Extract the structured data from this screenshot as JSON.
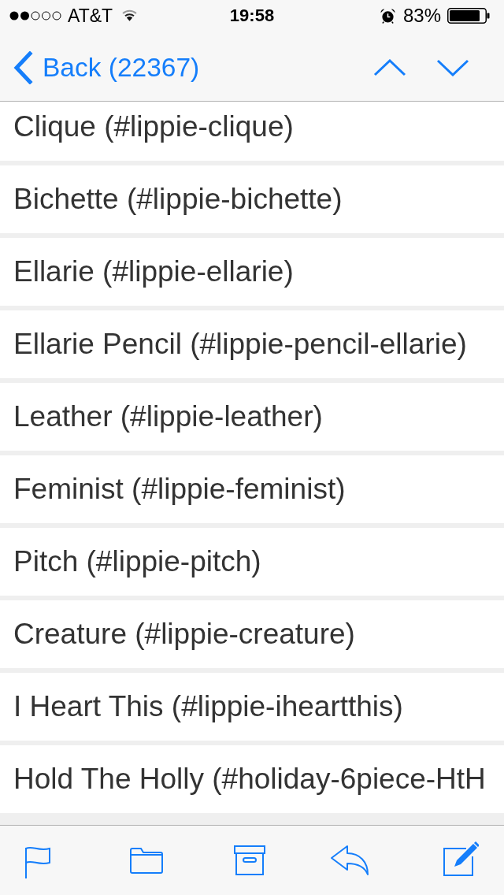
{
  "status_bar": {
    "carrier": "AT&T",
    "time": "19:58",
    "battery": "83%"
  },
  "nav": {
    "back_label": "Back (22367)"
  },
  "items": [
    "Clique (#lippie-clique)",
    "Bichette (#lippie-bichette)",
    "Ellarie (#lippie-ellarie)",
    "Ellarie Pencil (#lippie-pencil-ellarie)",
    "Leather (#lippie-leather)",
    "Feminist (#lippie-feminist)",
    "Pitch (#lippie-pitch)",
    "Creature (#lippie-creature)",
    "I Heart This (#lippie-iheartthis)",
    "Hold The Holly (#holiday-6piece-HtH"
  ]
}
